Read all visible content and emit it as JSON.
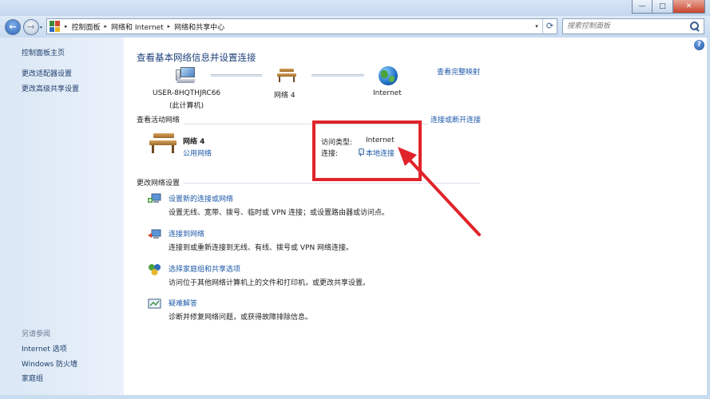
{
  "window": {
    "minimize_glyph": "—",
    "maximize_glyph": "□",
    "close_glyph": "✕"
  },
  "nav": {
    "back_glyph": "←",
    "forward_glyph": "→",
    "dropdown_glyph": "▾",
    "breadcrumb": [
      "控制面板",
      "网络和 Internet",
      "网络和共享中心"
    ],
    "separator": "▸",
    "address_dropdown_glyph": "▾",
    "refresh_glyph": "⟳"
  },
  "search": {
    "placeholder": "搜索控制面板"
  },
  "help": {
    "glyph": "?"
  },
  "sidebar": {
    "items": [
      "控制面板主页",
      "更改适配器设置",
      "更改高级共享设置"
    ],
    "see_also_heading": "另请参阅",
    "see_also": [
      "Internet 选项",
      "Windows 防火墙",
      "家庭组"
    ]
  },
  "main": {
    "title": "查看基本网络信息并设置连接",
    "view_full_map": "查看完整映射",
    "map": {
      "computer_name": "USER-8HQTHJRC66",
      "computer_sub": "(此计算机)",
      "network": "网络  4",
      "internet": "Internet"
    },
    "active_networks_heading": "查看活动网络",
    "connect_disconnect": "连接或断开连接",
    "active": {
      "name": "网络  4",
      "type": "公用网络",
      "access_type_label": "访问类型:",
      "access_type_value": "Internet",
      "connection_label": "连接:",
      "connection_value": "本地连接"
    },
    "change_settings_heading": "更改网络设置",
    "tasks": [
      {
        "title": "设置新的连接或网络",
        "desc": "设置无线、宽带、拨号、临时或 VPN 连接；或设置路由器或访问点。"
      },
      {
        "title": "连接到网络",
        "desc": "连接到或重新连接到无线、有线、拨号或 VPN 网络连接。"
      },
      {
        "title": "选择家庭组和共享选项",
        "desc": "访问位于其他网络计算机上的文件和打印机，或更改共享设置。"
      },
      {
        "title": "疑难解答",
        "desc": "诊断并修复网络问题，或获得故障排除信息。"
      }
    ]
  },
  "colors": {
    "link": "#1e5aa8",
    "title": "#1e3f7a",
    "highlight": "#e0242a",
    "sidebar_bg": "#dae7f5"
  }
}
